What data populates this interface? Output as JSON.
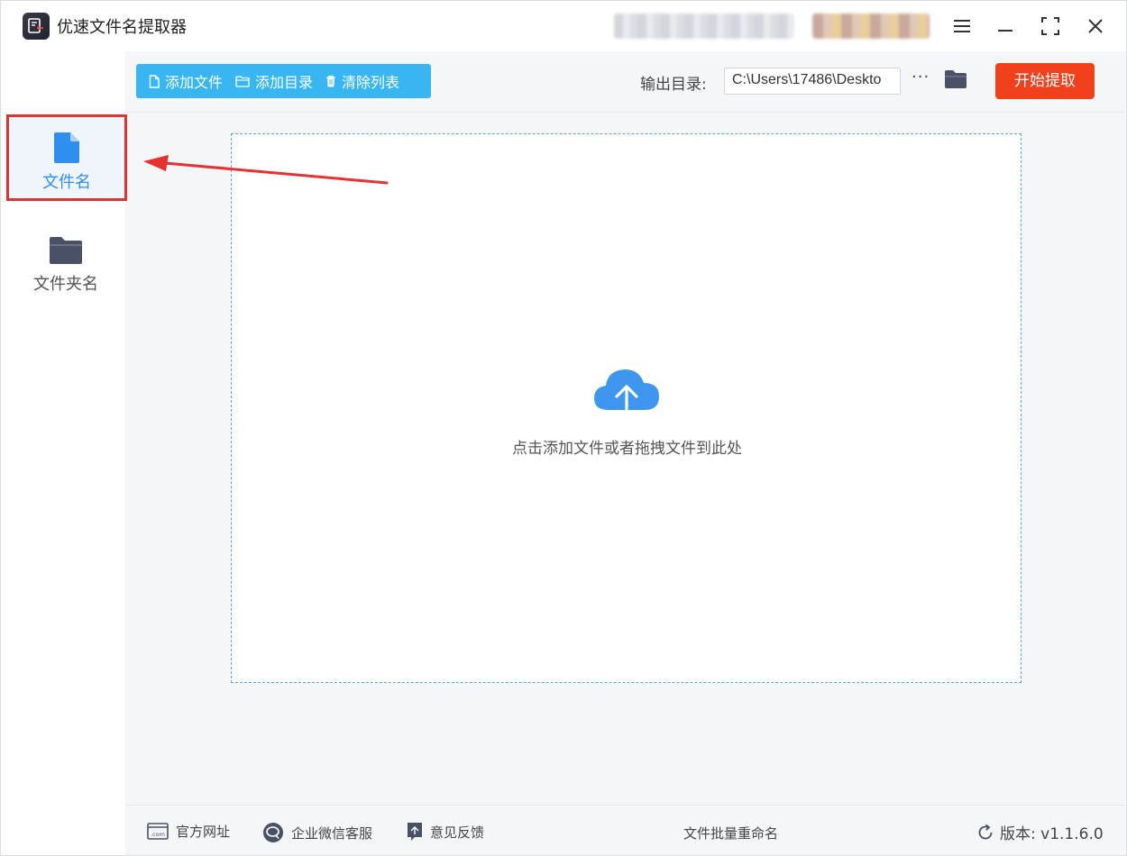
{
  "window": {
    "title": "优速文件名提取器"
  },
  "sidebar": {
    "items": [
      {
        "label": "文件名",
        "icon": "file-icon",
        "active": true
      },
      {
        "label": "文件夹名",
        "icon": "folder-icon",
        "active": false
      }
    ]
  },
  "toolbar": {
    "add_file": "添加文件",
    "add_dir": "添加目录",
    "clear_list": "清除列表",
    "output_label": "输出目录:",
    "output_path": "C:\\Users\\17486\\Deskto",
    "more": "···",
    "start": "开始提取"
  },
  "dropzone": {
    "hint": "点击添加文件或者拖拽文件到此处",
    "icon": "cloud-upload-icon"
  },
  "footer": {
    "website": "官方网址",
    "wecom": "企业微信客服",
    "feedback": "意见反馈",
    "center": "文件批量重命名",
    "version": "版本: v1.1.6.0"
  },
  "colors": {
    "accent_blue": "#38b6f2",
    "start_red": "#f0401c",
    "active_text": "#2f8ff0",
    "annotation_red": "#e63131"
  }
}
